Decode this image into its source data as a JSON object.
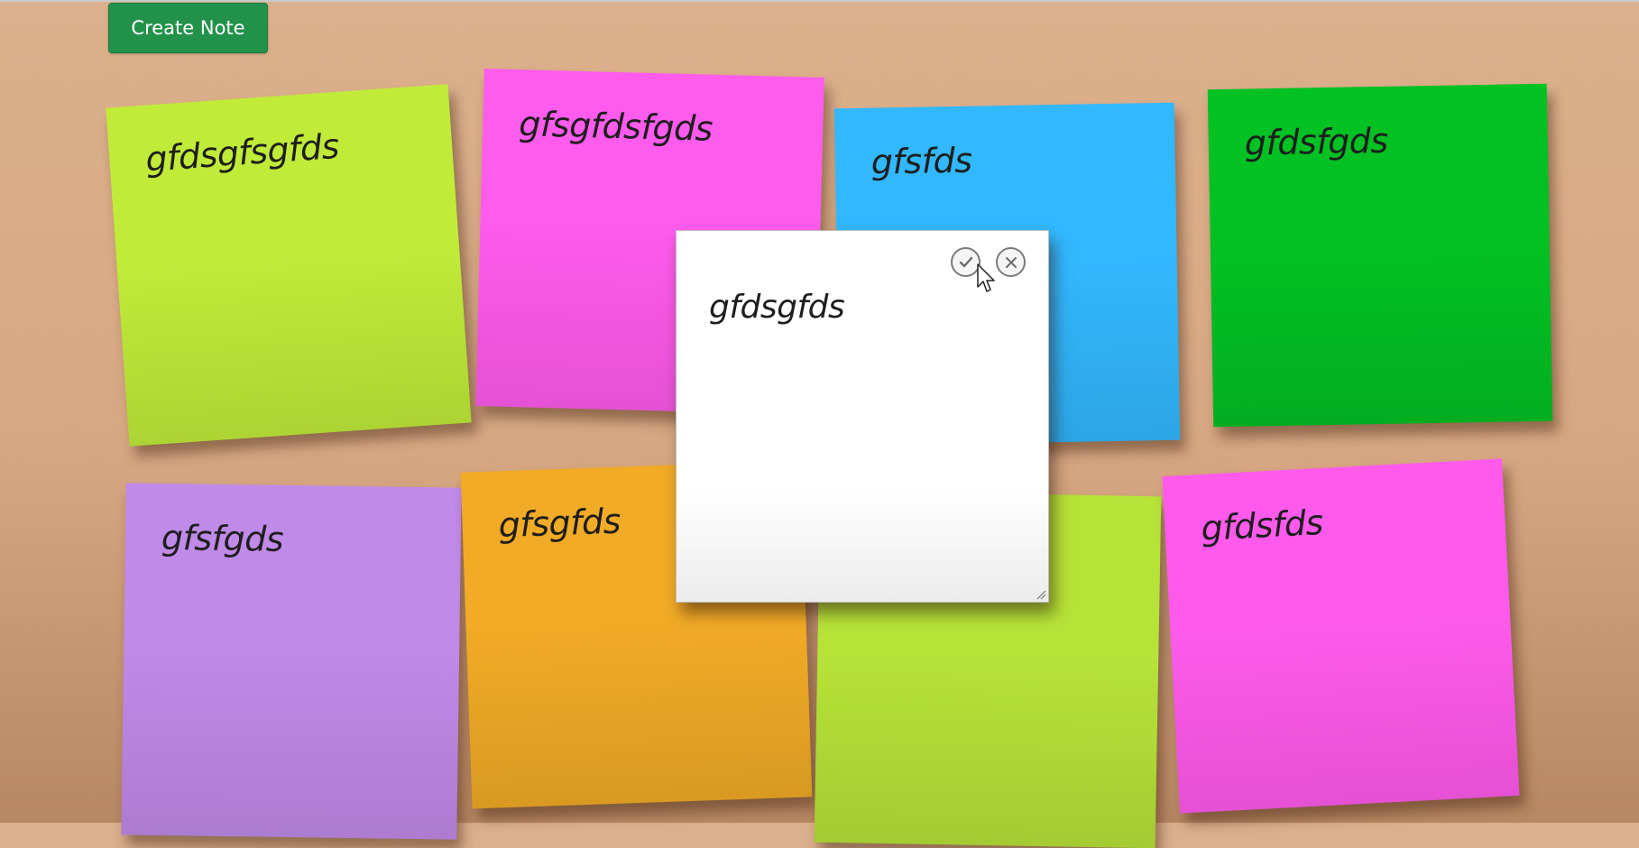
{
  "toolbar": {
    "create_label": "Create Note"
  },
  "notes": [
    {
      "text": "gfdsgfsgfds",
      "color": "#c0ec39"
    },
    {
      "text": "gfsgfdsfgds",
      "color": "#ff5bed"
    },
    {
      "text": "gfsfds",
      "color": "#32b8ff"
    },
    {
      "text": "gfdsfgds",
      "color": "#02c123"
    },
    {
      "text": "gfsfgds",
      "color": "#c08ae8"
    },
    {
      "text": "gfsgfds",
      "color": "#f2ab26"
    },
    {
      "text": "",
      "color": "#b6e338"
    },
    {
      "text": "gfdsfds",
      "color": "#ff5aec"
    }
  ],
  "editor": {
    "text": "gfdsgfds",
    "confirm_icon": "check-circle-icon",
    "cancel_icon": "close-circle-icon"
  },
  "colors": {
    "background": "#d9ad88",
    "button": "#22924a"
  }
}
